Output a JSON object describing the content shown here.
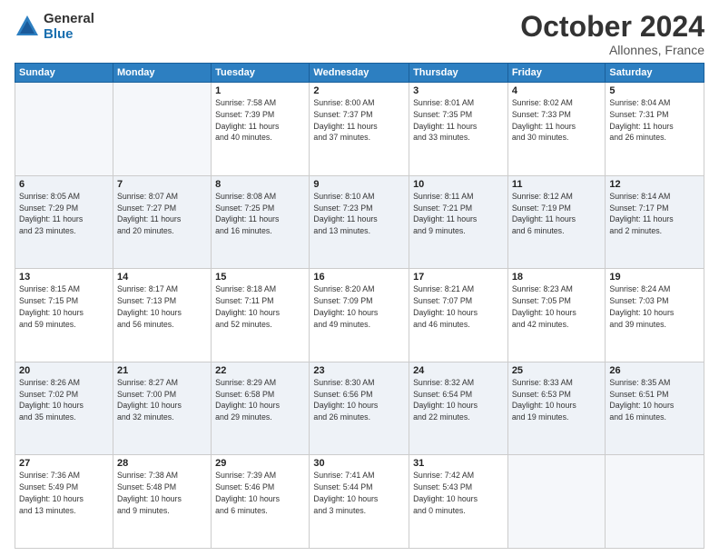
{
  "header": {
    "logo": {
      "general": "General",
      "blue": "Blue"
    },
    "title": "October 2024",
    "location": "Allonnes, France"
  },
  "weekdays": [
    "Sunday",
    "Monday",
    "Tuesday",
    "Wednesday",
    "Thursday",
    "Friday",
    "Saturday"
  ],
  "weeks": [
    [
      {
        "day": "",
        "detail": ""
      },
      {
        "day": "",
        "detail": ""
      },
      {
        "day": "1",
        "detail": "Sunrise: 7:58 AM\nSunset: 7:39 PM\nDaylight: 11 hours\nand 40 minutes."
      },
      {
        "day": "2",
        "detail": "Sunrise: 8:00 AM\nSunset: 7:37 PM\nDaylight: 11 hours\nand 37 minutes."
      },
      {
        "day": "3",
        "detail": "Sunrise: 8:01 AM\nSunset: 7:35 PM\nDaylight: 11 hours\nand 33 minutes."
      },
      {
        "day": "4",
        "detail": "Sunrise: 8:02 AM\nSunset: 7:33 PM\nDaylight: 11 hours\nand 30 minutes."
      },
      {
        "day": "5",
        "detail": "Sunrise: 8:04 AM\nSunset: 7:31 PM\nDaylight: 11 hours\nand 26 minutes."
      }
    ],
    [
      {
        "day": "6",
        "detail": "Sunrise: 8:05 AM\nSunset: 7:29 PM\nDaylight: 11 hours\nand 23 minutes."
      },
      {
        "day": "7",
        "detail": "Sunrise: 8:07 AM\nSunset: 7:27 PM\nDaylight: 11 hours\nand 20 minutes."
      },
      {
        "day": "8",
        "detail": "Sunrise: 8:08 AM\nSunset: 7:25 PM\nDaylight: 11 hours\nand 16 minutes."
      },
      {
        "day": "9",
        "detail": "Sunrise: 8:10 AM\nSunset: 7:23 PM\nDaylight: 11 hours\nand 13 minutes."
      },
      {
        "day": "10",
        "detail": "Sunrise: 8:11 AM\nSunset: 7:21 PM\nDaylight: 11 hours\nand 9 minutes."
      },
      {
        "day": "11",
        "detail": "Sunrise: 8:12 AM\nSunset: 7:19 PM\nDaylight: 11 hours\nand 6 minutes."
      },
      {
        "day": "12",
        "detail": "Sunrise: 8:14 AM\nSunset: 7:17 PM\nDaylight: 11 hours\nand 2 minutes."
      }
    ],
    [
      {
        "day": "13",
        "detail": "Sunrise: 8:15 AM\nSunset: 7:15 PM\nDaylight: 10 hours\nand 59 minutes."
      },
      {
        "day": "14",
        "detail": "Sunrise: 8:17 AM\nSunset: 7:13 PM\nDaylight: 10 hours\nand 56 minutes."
      },
      {
        "day": "15",
        "detail": "Sunrise: 8:18 AM\nSunset: 7:11 PM\nDaylight: 10 hours\nand 52 minutes."
      },
      {
        "day": "16",
        "detail": "Sunrise: 8:20 AM\nSunset: 7:09 PM\nDaylight: 10 hours\nand 49 minutes."
      },
      {
        "day": "17",
        "detail": "Sunrise: 8:21 AM\nSunset: 7:07 PM\nDaylight: 10 hours\nand 46 minutes."
      },
      {
        "day": "18",
        "detail": "Sunrise: 8:23 AM\nSunset: 7:05 PM\nDaylight: 10 hours\nand 42 minutes."
      },
      {
        "day": "19",
        "detail": "Sunrise: 8:24 AM\nSunset: 7:03 PM\nDaylight: 10 hours\nand 39 minutes."
      }
    ],
    [
      {
        "day": "20",
        "detail": "Sunrise: 8:26 AM\nSunset: 7:02 PM\nDaylight: 10 hours\nand 35 minutes."
      },
      {
        "day": "21",
        "detail": "Sunrise: 8:27 AM\nSunset: 7:00 PM\nDaylight: 10 hours\nand 32 minutes."
      },
      {
        "day": "22",
        "detail": "Sunrise: 8:29 AM\nSunset: 6:58 PM\nDaylight: 10 hours\nand 29 minutes."
      },
      {
        "day": "23",
        "detail": "Sunrise: 8:30 AM\nSunset: 6:56 PM\nDaylight: 10 hours\nand 26 minutes."
      },
      {
        "day": "24",
        "detail": "Sunrise: 8:32 AM\nSunset: 6:54 PM\nDaylight: 10 hours\nand 22 minutes."
      },
      {
        "day": "25",
        "detail": "Sunrise: 8:33 AM\nSunset: 6:53 PM\nDaylight: 10 hours\nand 19 minutes."
      },
      {
        "day": "26",
        "detail": "Sunrise: 8:35 AM\nSunset: 6:51 PM\nDaylight: 10 hours\nand 16 minutes."
      }
    ],
    [
      {
        "day": "27",
        "detail": "Sunrise: 7:36 AM\nSunset: 5:49 PM\nDaylight: 10 hours\nand 13 minutes."
      },
      {
        "day": "28",
        "detail": "Sunrise: 7:38 AM\nSunset: 5:48 PM\nDaylight: 10 hours\nand 9 minutes."
      },
      {
        "day": "29",
        "detail": "Sunrise: 7:39 AM\nSunset: 5:46 PM\nDaylight: 10 hours\nand 6 minutes."
      },
      {
        "day": "30",
        "detail": "Sunrise: 7:41 AM\nSunset: 5:44 PM\nDaylight: 10 hours\nand 3 minutes."
      },
      {
        "day": "31",
        "detail": "Sunrise: 7:42 AM\nSunset: 5:43 PM\nDaylight: 10 hours\nand 0 minutes."
      },
      {
        "day": "",
        "detail": ""
      },
      {
        "day": "",
        "detail": ""
      }
    ]
  ]
}
